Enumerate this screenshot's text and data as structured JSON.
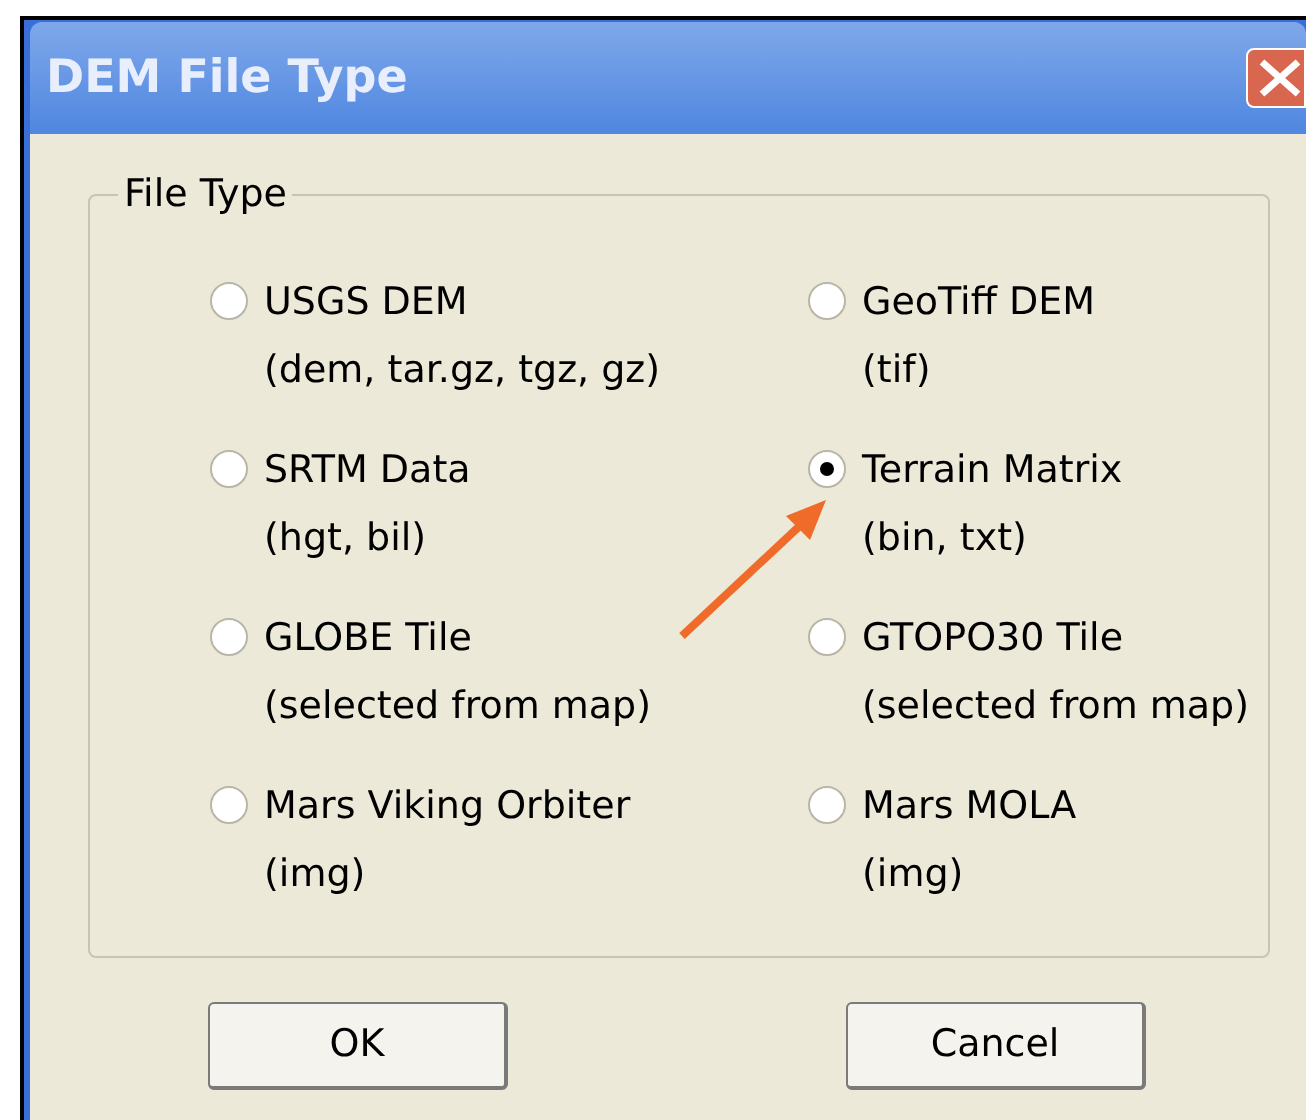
{
  "window": {
    "title": "DEM File Type"
  },
  "group": {
    "label": "File Type",
    "options": [
      {
        "label": "USGS DEM",
        "extensions": "(dem, tar.gz, tgz, gz)",
        "selected": false
      },
      {
        "label": "GeoTiff DEM",
        "extensions": "(tif)",
        "selected": false
      },
      {
        "label": "SRTM Data",
        "extensions": "(hgt, bil)",
        "selected": false
      },
      {
        "label": "Terrain Matrix",
        "extensions": "(bin, txt)",
        "selected": true
      },
      {
        "label": "GLOBE Tile",
        "extensions": "(selected from map)",
        "selected": false
      },
      {
        "label": "GTOPO30 Tile",
        "extensions": "(selected from map)",
        "selected": false
      },
      {
        "label": "Mars Viking Orbiter",
        "extensions": "(img)",
        "selected": false
      },
      {
        "label": "Mars MOLA",
        "extensions": "(img)",
        "selected": false
      }
    ]
  },
  "buttons": [
    "OK",
    "Cancel"
  ]
}
